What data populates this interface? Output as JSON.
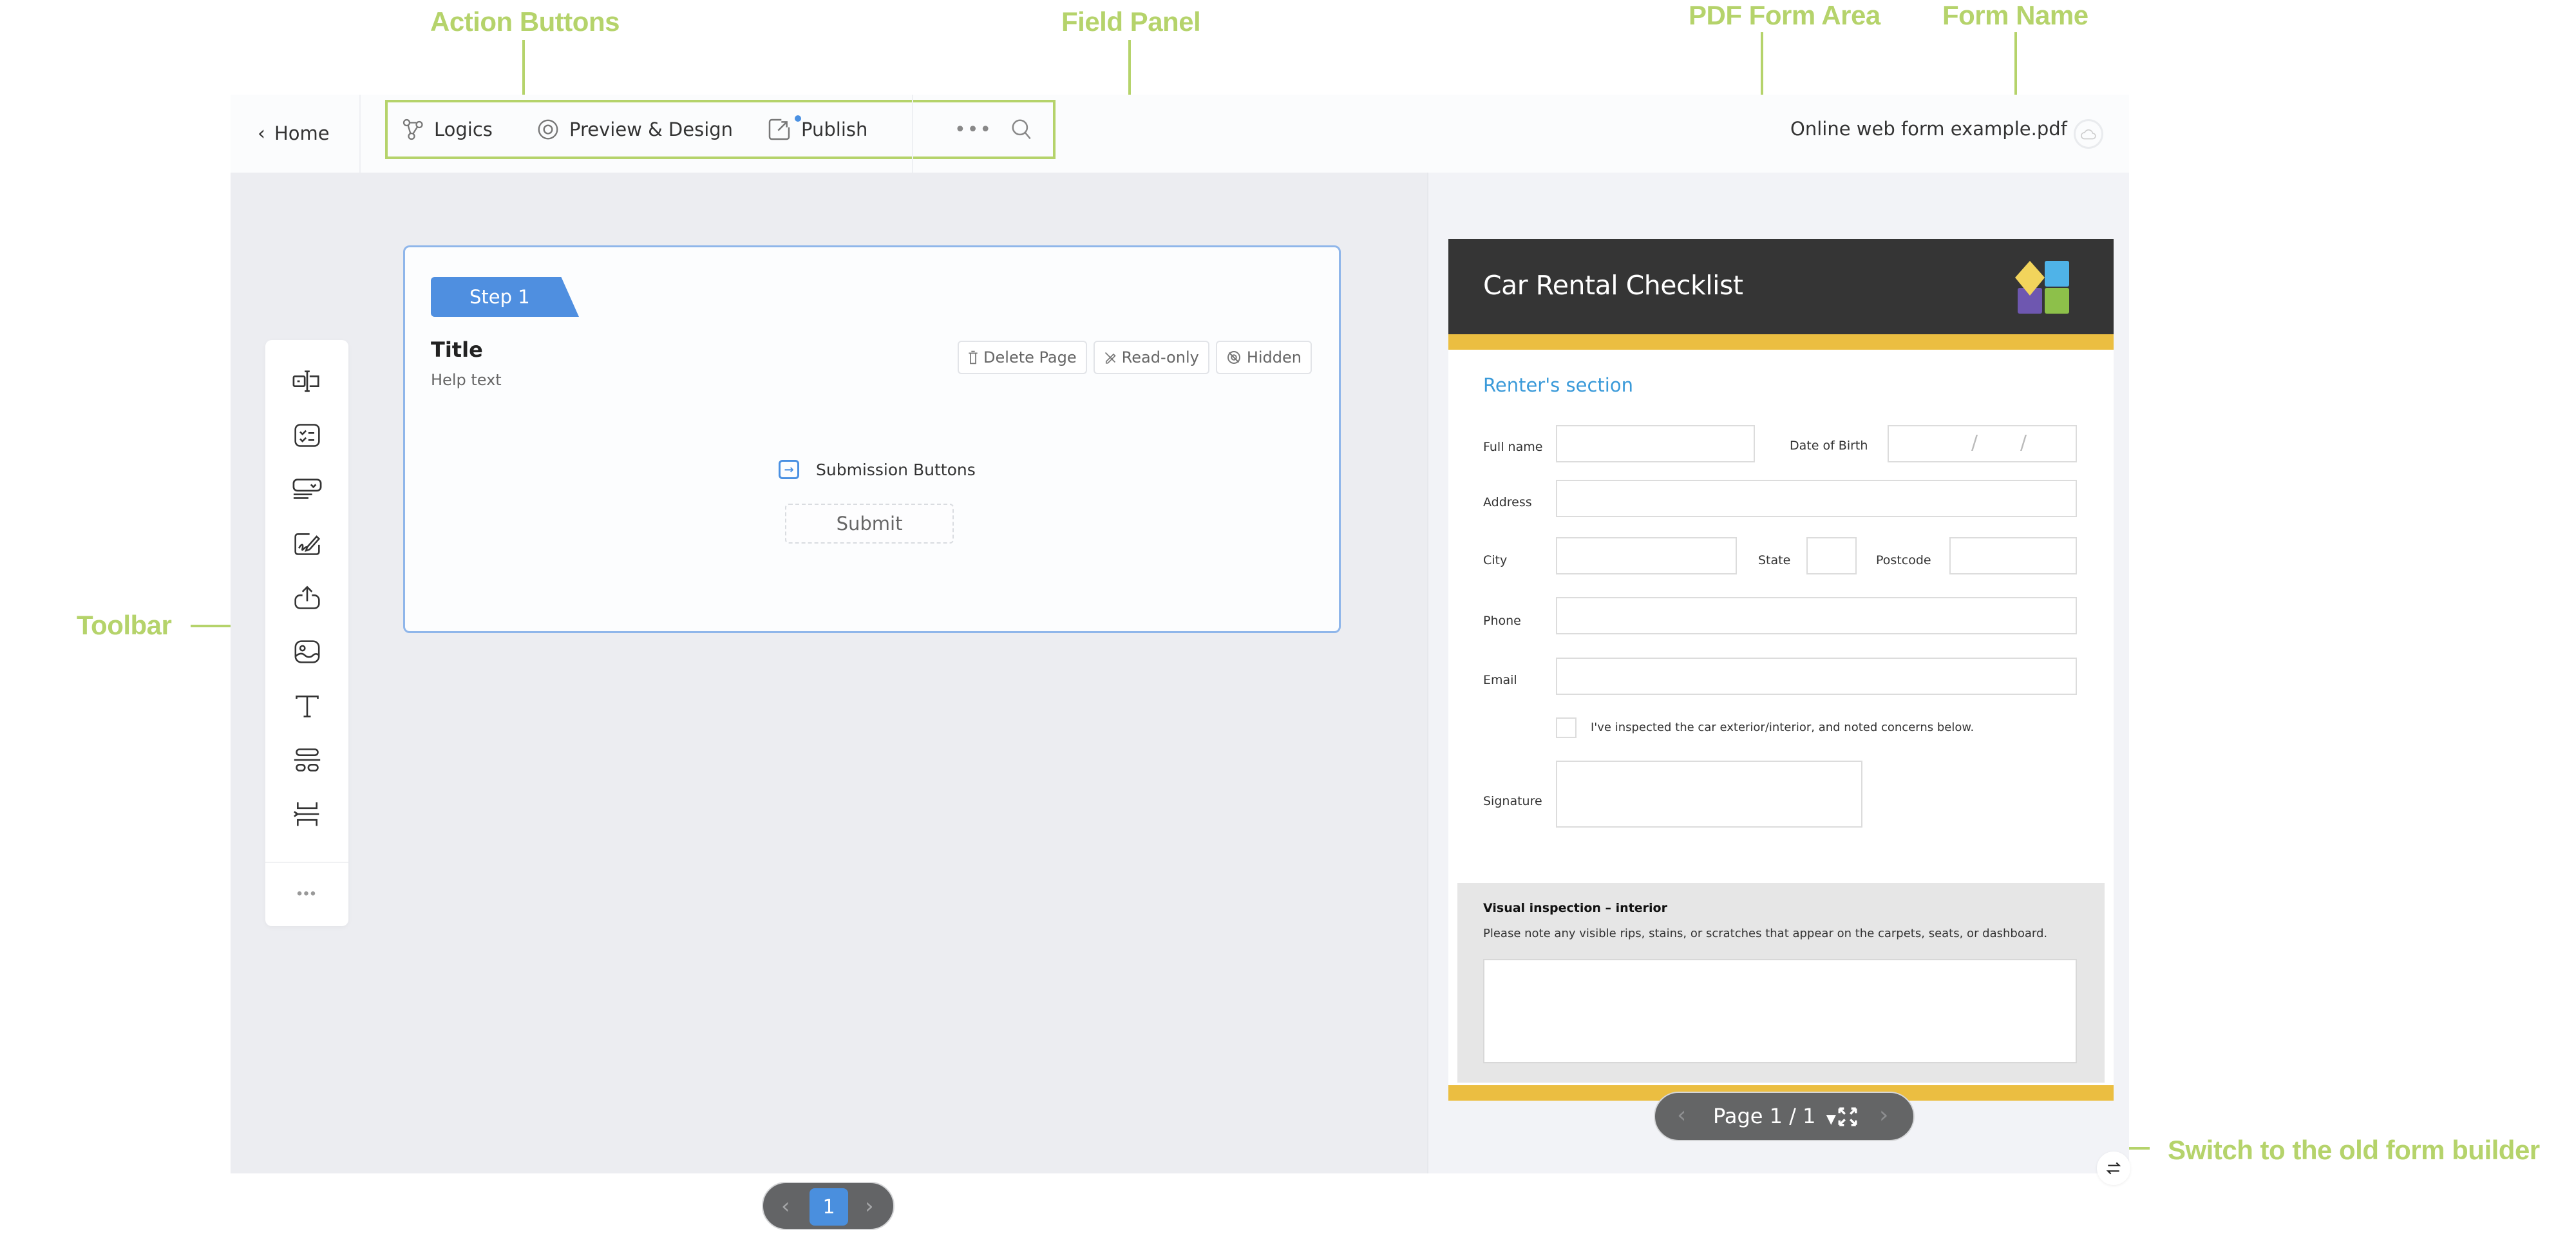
{
  "annotations": {
    "action_buttons": "Action Buttons",
    "field_panel": "Field Panel",
    "pdf_form_area": "PDF Form Area",
    "form_name": "Form Name",
    "toolbar": "Toolbar",
    "switch_builder": "Switch to the old form builder",
    "color": "#b5d36b"
  },
  "header": {
    "home_label": "Home",
    "actions": [
      {
        "label": "Logics",
        "icon": "logic-flow-icon"
      },
      {
        "label": "Preview & Design",
        "icon": "eye-icon"
      },
      {
        "label": "Publish",
        "icon": "share-external-icon",
        "badge": true
      }
    ],
    "more_icon": "more-dots-icon",
    "search_icon": "search-icon",
    "form_name": "Online web form example.pdf",
    "cloud_icon": "cloud-save-icon"
  },
  "toolbar": {
    "tools": [
      {
        "name": "text-input-tool",
        "icon": "text-input-icon"
      },
      {
        "name": "checkbox-tool",
        "icon": "checklist-icon"
      },
      {
        "name": "dropdown-tool",
        "icon": "dropdown-icon"
      },
      {
        "name": "signature-tool",
        "icon": "signature-icon"
      },
      {
        "name": "upload-tool",
        "icon": "upload-icon"
      },
      {
        "name": "image-tool",
        "icon": "image-icon"
      },
      {
        "name": "text-tool",
        "icon": "text-icon"
      },
      {
        "name": "layout-tool",
        "icon": "layout-icon"
      },
      {
        "name": "page-break-tool",
        "icon": "page-break-icon"
      }
    ],
    "more_icon": "more-dots-icon"
  },
  "field_panel": {
    "step_label": "Step 1",
    "title": "Title",
    "help_text": "Help text",
    "buttons": {
      "delete_page": "Delete Page",
      "read_only": "Read-only",
      "hidden": "Hidden"
    },
    "submission_label": "Submission Buttons",
    "submit_label": "Submit",
    "accent": "#4f8fe0"
  },
  "left_pager": {
    "current_page": "1"
  },
  "pdf": {
    "title": "Car Rental Checklist",
    "section": "Renter's section",
    "fields": {
      "full_name": "Full name",
      "dob": "Date of Birth",
      "dob_separator": "/",
      "address": "Address",
      "city": "City",
      "state": "State",
      "postcode": "Postcode",
      "phone": "Phone",
      "email": "Email",
      "checkbox_text": "I've inspected the car exterior/interior, and noted concerns below.",
      "signature": "Signature"
    },
    "inspection": {
      "title": "Visual inspection – interior",
      "description": "Please note any visible rips, stains, or scratches that appear on the carpets, seats, or dashboard."
    },
    "colors": {
      "header": "#353535",
      "stripe": "#ebbe41",
      "section": "#3a9ad9"
    }
  },
  "pdf_pager": {
    "label": "Page 1 / 1",
    "fullscreen_icon": "fullscreen-icon"
  },
  "switch_builder_icon": "switch-arrows-icon"
}
